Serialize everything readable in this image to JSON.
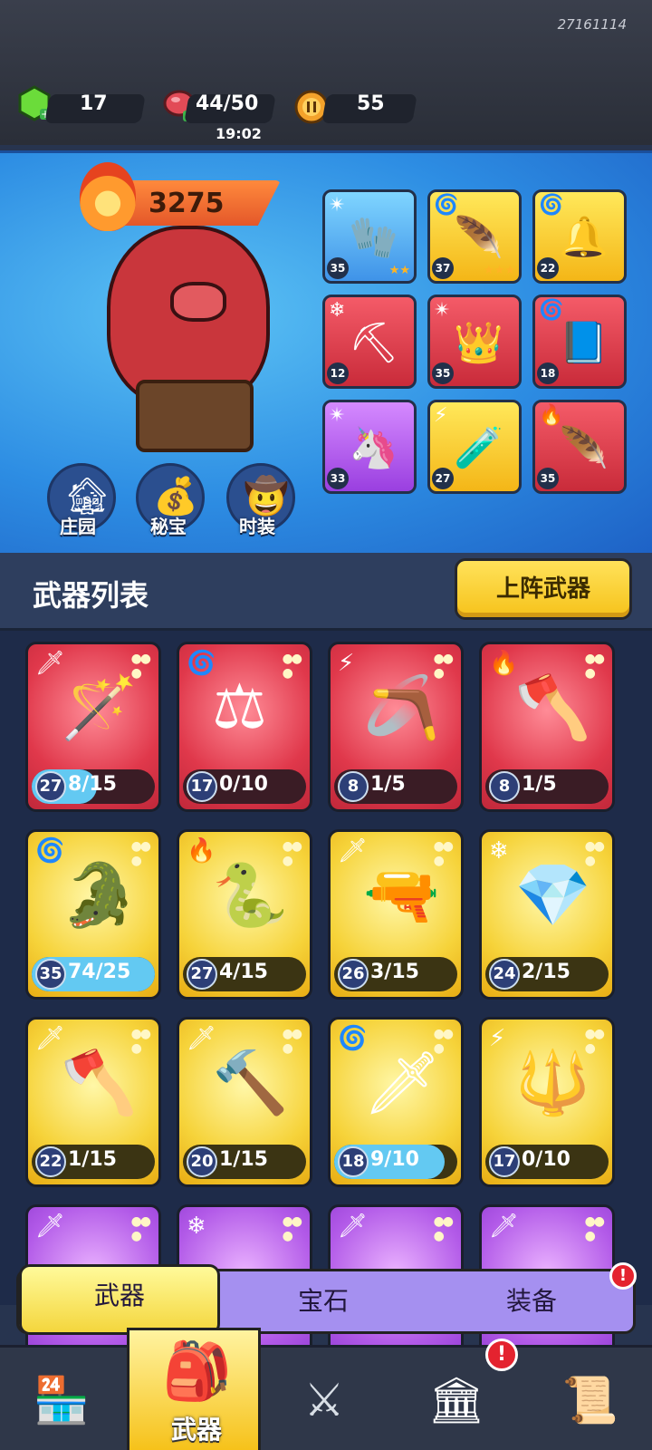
{
  "top_bar": {
    "build_id": "27161114",
    "gems": "17",
    "energy": "44/50",
    "energy_timer": "19:02",
    "coins": "55"
  },
  "hero": {
    "power": "3275",
    "quick_buttons": [
      {
        "label": "庄园",
        "icon": "manor-icon"
      },
      {
        "label": "秘宝",
        "icon": "treasure-icon"
      },
      {
        "label": "时装",
        "icon": "costume-icon"
      }
    ],
    "equipped": [
      {
        "level": "35",
        "rarity": "blue",
        "element": "spark",
        "icon": "glove-icon",
        "glyph": "🧤",
        "stars": "★★"
      },
      {
        "level": "37",
        "rarity": "gold",
        "element": "wind",
        "icon": "feather-icon",
        "glyph": "🪶",
        "stars": "★★★"
      },
      {
        "level": "22",
        "rarity": "gold",
        "element": "wind",
        "icon": "bell-icon",
        "glyph": "🔔",
        "stars": ""
      },
      {
        "level": "12",
        "rarity": "red",
        "element": "ice",
        "icon": "pickaxe-icon",
        "glyph": "⛏",
        "stars": ""
      },
      {
        "level": "35",
        "rarity": "red",
        "element": "spark",
        "icon": "crown-icon",
        "glyph": "👑",
        "stars": ""
      },
      {
        "level": "18",
        "rarity": "red",
        "element": "wind",
        "icon": "spellbook-icon",
        "glyph": "📘",
        "stars": ""
      },
      {
        "level": "33",
        "rarity": "purple",
        "element": "spark",
        "icon": "crystal-horn-icon",
        "glyph": "🦄",
        "stars": ""
      },
      {
        "level": "27",
        "rarity": "gold",
        "element": "lightning",
        "icon": "flask-icon",
        "glyph": "🧪",
        "stars": ""
      },
      {
        "level": "35",
        "rarity": "red",
        "element": "fire",
        "icon": "feather-staff-icon",
        "glyph": "🪶",
        "stars": ""
      }
    ]
  },
  "weapon_list": {
    "title": "武器列表",
    "deploy_button": "上阵武器",
    "cards": [
      {
        "level": "27",
        "progress": "8/15",
        "fill": 0.53,
        "rarity": "red",
        "element": "sword",
        "icon": "scepter-icon",
        "glyph": "🪄"
      },
      {
        "level": "17",
        "progress": "0/10",
        "fill": 0,
        "rarity": "red",
        "element": "wind",
        "icon": "anvil-icon",
        "glyph": "⚖"
      },
      {
        "level": "8",
        "progress": "1/5",
        "fill": 0.2,
        "rarity": "red",
        "element": "lightning",
        "icon": "boomerang-icon",
        "glyph": "🪃"
      },
      {
        "level": "8",
        "progress": "1/5",
        "fill": 0.2,
        "rarity": "red",
        "element": "fire",
        "icon": "axe-icon",
        "glyph": "🪓"
      },
      {
        "level": "35",
        "progress": "74/25",
        "fill": 1,
        "rarity": "gold",
        "element": "wind",
        "icon": "crocodile-bow-icon",
        "glyph": "🐊"
      },
      {
        "level": "27",
        "progress": "4/15",
        "fill": 0.27,
        "rarity": "gold",
        "element": "fire",
        "icon": "serpent-icon",
        "glyph": "🐍"
      },
      {
        "level": "26",
        "progress": "3/15",
        "fill": 0.2,
        "rarity": "gold",
        "element": "sword",
        "icon": "pistol-icon",
        "glyph": "🔫"
      },
      {
        "level": "24",
        "progress": "2/15",
        "fill": 0.13,
        "rarity": "gold",
        "element": "ice",
        "icon": "ice-gauntlet-icon",
        "glyph": "💎"
      },
      {
        "level": "22",
        "progress": "1/15",
        "fill": 0.07,
        "rarity": "gold",
        "element": "sword",
        "icon": "battle-axe-icon",
        "glyph": "🪓"
      },
      {
        "level": "20",
        "progress": "1/15",
        "fill": 0.07,
        "rarity": "gold",
        "element": "sword",
        "icon": "hammer-icon",
        "glyph": "🔨"
      },
      {
        "level": "18",
        "progress": "9/10",
        "fill": 0.9,
        "rarity": "gold",
        "element": "wind",
        "icon": "spear-icon",
        "glyph": "🗡"
      },
      {
        "level": "17",
        "progress": "0/10",
        "fill": 0,
        "rarity": "gold",
        "element": "lightning",
        "icon": "mace-icon",
        "glyph": "🔱"
      },
      {
        "level": "",
        "progress": "",
        "fill": 0,
        "rarity": "purple",
        "element": "sword",
        "icon": "weapon-icon",
        "glyph": ""
      },
      {
        "level": "",
        "progress": "",
        "fill": 0,
        "rarity": "purple",
        "element": "ice",
        "icon": "weapon-icon",
        "glyph": ""
      },
      {
        "level": "",
        "progress": "",
        "fill": 0,
        "rarity": "purple",
        "element": "sword",
        "icon": "weapon-icon",
        "glyph": ""
      },
      {
        "level": "",
        "progress": "",
        "fill": 0,
        "rarity": "purple",
        "element": "sword",
        "icon": "weapon-icon",
        "glyph": ""
      }
    ]
  },
  "sub_tabs": [
    {
      "label": "武器",
      "active": true
    },
    {
      "label": "宝石",
      "active": false
    },
    {
      "label": "装备",
      "active": false,
      "alert": "!"
    }
  ],
  "bottom_nav": [
    {
      "icon": "shop-icon",
      "glyph": "🏪",
      "label": ""
    },
    {
      "icon": "backpack-icon",
      "glyph": "🎒",
      "label": "武器",
      "active": true
    },
    {
      "icon": "battle-icon",
      "glyph": "⚔",
      "label": ""
    },
    {
      "icon": "building-icon",
      "glyph": "🏛",
      "label": "",
      "alert": "!"
    },
    {
      "icon": "scroll-icon",
      "glyph": "📜",
      "label": ""
    }
  ],
  "colors": {
    "gold": "#f6c21a",
    "red": "#e0384b",
    "purple": "#b25ae8",
    "blue": "#3f93e8",
    "alert": "#e4232f"
  }
}
